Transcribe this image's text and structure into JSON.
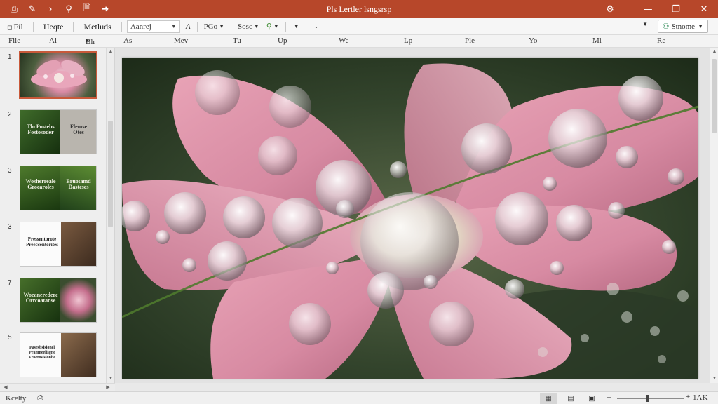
{
  "titlebar": {
    "title": "Pls Lertler lsngsrsp",
    "quick_access": [
      "save-icon",
      "edit-icon",
      "redo-icon",
      "search-icon",
      "document-icon",
      "share-arrow-icon"
    ],
    "color": "#b7472a"
  },
  "ribbon": {
    "tabs": [
      "Fil",
      "Heqte",
      "Metluds"
    ],
    "font_name": "Aanrej",
    "font_style": "A",
    "font_size": "PGo",
    "sort_label": "Sosc",
    "share_label": "Stnome"
  },
  "ruler": {
    "labels": [
      "File",
      "Al",
      "Blr",
      "As",
      "Mev",
      "Tu",
      "Up",
      "We",
      "Lp",
      "Ple",
      "Yo",
      "Ml",
      "Re"
    ]
  },
  "slides": {
    "numbers": [
      "1",
      "2",
      "3",
      "3",
      "7",
      "5"
    ],
    "s2": {
      "title": "Tlo Postebs\nFostosoder",
      "right": "Flemse\nOtes"
    },
    "s3": {
      "title": "Wosherreale\nGrocaroles",
      "right": "Bruotamd\nDasteses"
    },
    "s4": {
      "title": "Pressentorote\nPreeccentorites"
    },
    "s5": {
      "title": "Woeaneredere\nOrrcoatanse"
    },
    "s6": {
      "title": "Pasesbsisionel\nPramneelisgne\nFroerosisionbe"
    }
  },
  "status": {
    "text": "Kcelty",
    "zoom": "1AK",
    "zoom_fraction": 0.45
  }
}
